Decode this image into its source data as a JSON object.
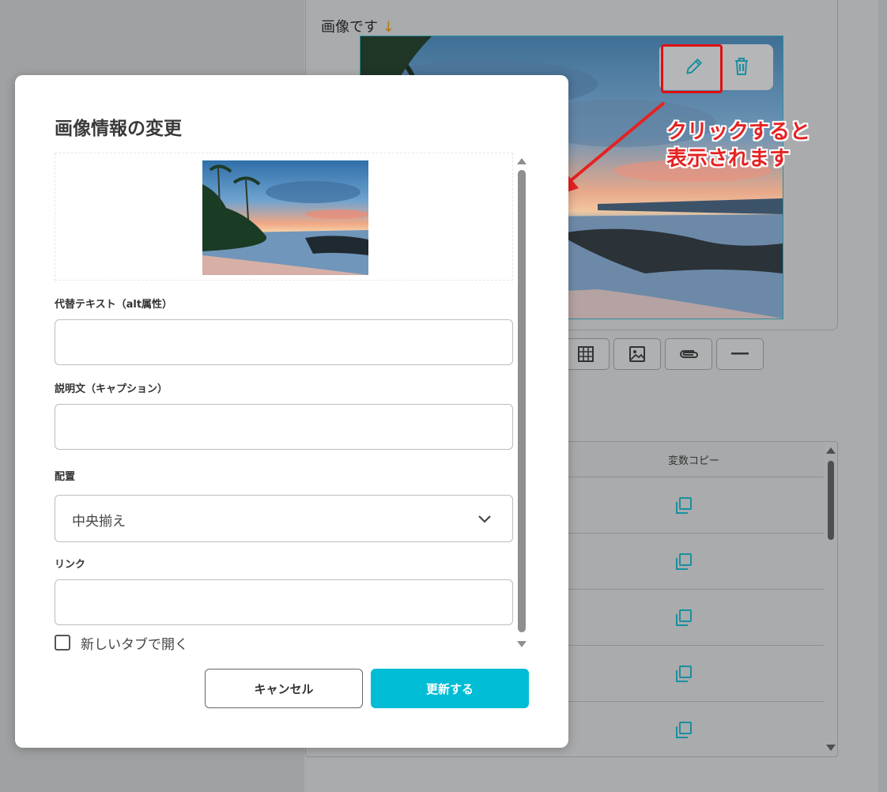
{
  "background": {
    "editor_text": "画像です",
    "editor_text_arrow": "↓",
    "callout_line1": "クリックすると",
    "callout_line2": "表示されます",
    "variable_table": {
      "column_header": "変数コピー",
      "row_count": 5
    }
  },
  "modal": {
    "title": "画像情報の変更",
    "alt_label": "代替テキスト（alt属性）",
    "alt_value": "",
    "caption_label": "説明文（キャプション）",
    "caption_value": "",
    "align_label": "配置",
    "align_value": "中央揃え",
    "link_label": "リンク",
    "link_value": "",
    "new_tab_label": "新しいタブで開く",
    "new_tab_checked": false,
    "cancel_label": "キャンセル",
    "update_label": "更新する"
  },
  "colors": {
    "accent": "#00bcd4",
    "highlight_red": "#e01010",
    "icon_teal": "#1a8f9e"
  }
}
